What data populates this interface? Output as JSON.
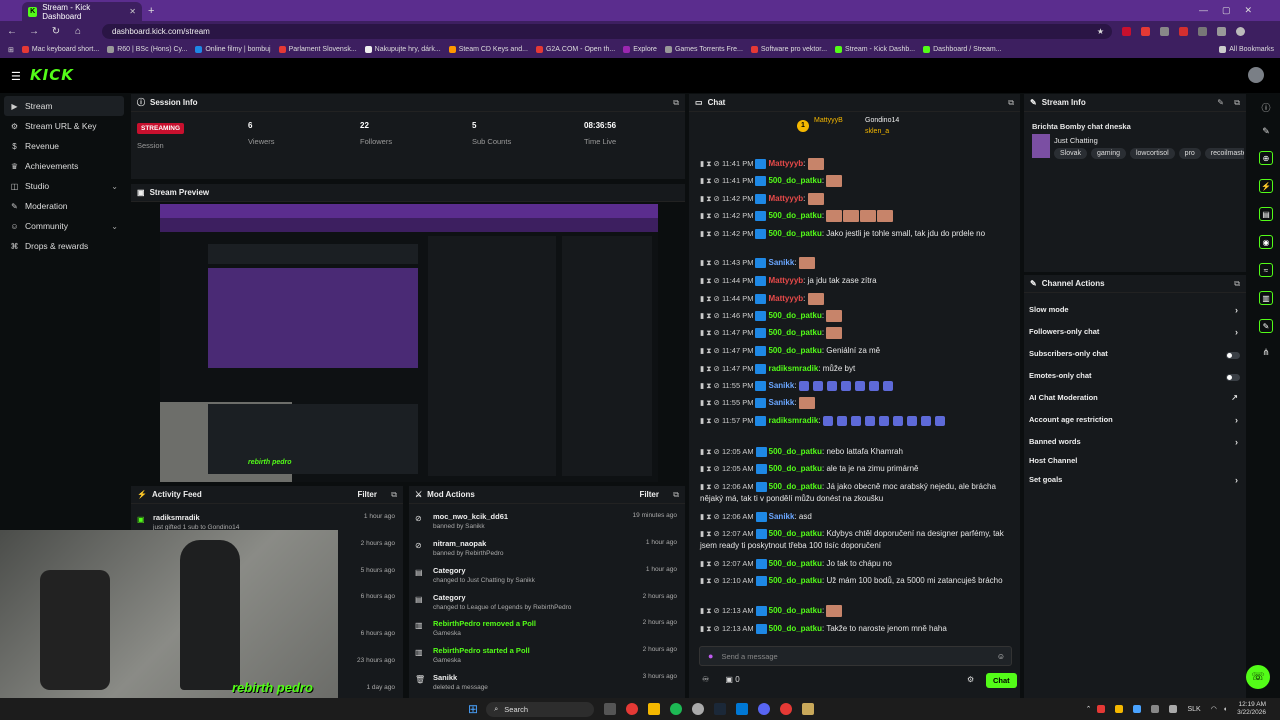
{
  "browser": {
    "tab_title": "Stream - Kick Dashboard",
    "url": "dashboard.kick.com/stream",
    "bookmarks": [
      "Mac keyboard short...",
      "R60 | BSc (Hons) Cy...",
      "Online filmy | bombuj",
      "Parlament Slovensk...",
      "Nakupujte hry, dárk...",
      "Steam CD Keys and...",
      "G2A.COM - Open th...",
      "Explore",
      "Games Torrents Fre...",
      "Software pro vektor...",
      "Stream - Kick Dashb...",
      "Dashboard / Stream..."
    ],
    "all_bookmarks": "All Bookmarks"
  },
  "brand": {
    "logo": "KICK",
    "accent": "#53fc18"
  },
  "sidebar": {
    "items": [
      {
        "label": "Stream",
        "icon": "play-icon"
      },
      {
        "label": "Stream URL & Key",
        "icon": "key-icon"
      },
      {
        "label": "Revenue",
        "icon": "dollar-icon"
      },
      {
        "label": "Achievements",
        "icon": "trophy-icon"
      },
      {
        "label": "Studio",
        "icon": "studio-icon"
      },
      {
        "label": "Moderation",
        "icon": "wrench-icon"
      },
      {
        "label": "Community",
        "icon": "people-icon"
      },
      {
        "label": "Drops & rewards",
        "icon": "gift-icon"
      }
    ]
  },
  "session": {
    "title": "Session Info",
    "badge": "STREAMING",
    "label": "Session",
    "stats": [
      {
        "value": "6",
        "label": "Viewers"
      },
      {
        "value": "22",
        "label": "Followers"
      },
      {
        "value": "5",
        "label": "Sub Counts"
      },
      {
        "value": "08:36:56",
        "label": "Time Live"
      }
    ]
  },
  "preview": {
    "title": "Stream Preview",
    "overlay_text": "rebirth pedro"
  },
  "activity": {
    "title": "Activity Feed",
    "filter": "Filter",
    "rows": [
      {
        "name": "radiksmradik",
        "sub": "just gifted 1 sub to Gondino14",
        "time": "1 hour ago"
      },
      {
        "name": "",
        "sub": "",
        "time": "2 hours ago"
      },
      {
        "name": "",
        "sub": "",
        "time": "5 hours ago"
      },
      {
        "name": "",
        "sub": "",
        "time": "6 hours ago"
      },
      {
        "name": "",
        "sub": "",
        "time": "6 hours ago"
      },
      {
        "name": "",
        "sub": "",
        "time": "23 hours ago"
      },
      {
        "name": "",
        "sub": "",
        "time": "1 day ago"
      }
    ]
  },
  "mod": {
    "title": "Mod Actions",
    "filter": "Filter",
    "rows": [
      {
        "title": "moc_nwo_kcik_dd61",
        "sub": "banned by Sanikk",
        "time": "19 minutes ago"
      },
      {
        "title": "nitram_naopak",
        "sub": "banned by RebirthPedro",
        "time": "1 hour ago"
      },
      {
        "title": "Category",
        "sub": "changed to Just Chatting by Sanikk",
        "time": "1 hour ago"
      },
      {
        "title": "Category",
        "sub": "changed to League of Legends by RebirthPedro",
        "time": "2 hours ago"
      },
      {
        "title": "RebirthPedro removed a Poll",
        "sub": "Gameska",
        "time": "2 hours ago"
      },
      {
        "title": "RebirthPedro started a Poll",
        "sub": "Gameska",
        "time": "2 hours ago"
      },
      {
        "title": "Sanikk",
        "sub": "deleted a message",
        "time": "3 hours ago"
      }
    ]
  },
  "chat": {
    "title": "Chat",
    "pinned": [
      {
        "name": "MattyyyB",
        "count": "1"
      },
      {
        "name": "Gondino14",
        "count": "1"
      },
      {
        "name": "sklen_a",
        "count": "1"
      }
    ],
    "messages": [
      {
        "time": "11:41 PM",
        "user": "Mattyyyb",
        "color": "#e84a4a",
        "text": "",
        "emotes": 1
      },
      {
        "time": "11:41 PM",
        "user": "500_do_patku",
        "color": "#53fc18",
        "text": "",
        "emotes": 1
      },
      {
        "time": "11:42 PM",
        "user": "Mattyyyb",
        "color": "#e84a4a",
        "text": "",
        "emotes": 1
      },
      {
        "time": "11:42 PM",
        "user": "500_do_patku",
        "color": "#53fc18",
        "text": "",
        "emotes": 4
      },
      {
        "time": "11:42 PM",
        "user": "500_do_patku",
        "color": "#53fc18",
        "text": "Jako jestli je tohle small, tak jdu do prdele no",
        "emotes": 0
      },
      {
        "time": "11:43 PM",
        "user": "Sanikk",
        "color": "#6aa6ff",
        "text": "",
        "emotes": 1
      },
      {
        "time": "11:44 PM",
        "user": "Mattyyyb",
        "color": "#e84a4a",
        "text": "ja jdu tak zase zítra",
        "emotes": 0
      },
      {
        "time": "11:44 PM",
        "user": "Mattyyyb",
        "color": "#e84a4a",
        "text": "",
        "emotes": 1
      },
      {
        "time": "11:46 PM",
        "user": "500_do_patku",
        "color": "#53fc18",
        "text": "",
        "emotes": 1
      },
      {
        "time": "11:47 PM",
        "user": "500_do_patku",
        "color": "#53fc18",
        "text": "",
        "emotes": 1
      },
      {
        "time": "11:47 PM",
        "user": "500_do_patku",
        "color": "#53fc18",
        "text": "Geniální za mě",
        "emotes": 0
      },
      {
        "time": "11:47 PM",
        "user": "radiksmradik",
        "color": "#53fc18",
        "text": "může byt",
        "emotes": 0
      },
      {
        "time": "11:55 PM",
        "user": "Sanikk",
        "color": "#6aa6ff",
        "text": "",
        "emotes": 7
      },
      {
        "time": "11:55 PM",
        "user": "Sanikk",
        "color": "#6aa6ff",
        "text": "",
        "emotes": 1
      },
      {
        "time": "11:57 PM",
        "user": "radiksmradik",
        "color": "#53fc18",
        "text": "",
        "emotes": 9
      },
      {
        "time": "12:05 AM",
        "user": "500_do_patku",
        "color": "#53fc18",
        "text": "nebo lattafa Khamrah",
        "emotes": 0
      },
      {
        "time": "12:05 AM",
        "user": "500_do_patku",
        "color": "#53fc18",
        "text": "ale ta je na zimu primárně",
        "emotes": 0
      },
      {
        "time": "12:06 AM",
        "user": "500_do_patku",
        "color": "#53fc18",
        "text": "Já jako obecně moc arabský nejedu, ale brácha nějaký má, tak ti v pondělí můžu donést na zkoušku",
        "emotes": 0
      },
      {
        "time": "12:06 AM",
        "user": "Sanikk",
        "color": "#6aa6ff",
        "text": "asd",
        "emotes": 0
      },
      {
        "time": "12:07 AM",
        "user": "500_do_patku",
        "color": "#53fc18",
        "text": "Kdybys chtěl doporučení na designer parfémy, tak jsem ready ti poskytnout třeba 100 tisíc doporučení",
        "emotes": 0
      },
      {
        "time": "12:07 AM",
        "user": "500_do_patku",
        "color": "#53fc18",
        "text": "Jo tak to chápu no",
        "emotes": 0
      },
      {
        "time": "12:10 AM",
        "user": "500_do_patku",
        "color": "#53fc18",
        "text": "Už mám 100 bodů, za 5000 mi zatancuješ brácho",
        "emotes": 0
      },
      {
        "time": "12:13 AM",
        "user": "500_do_patku",
        "color": "#53fc18",
        "text": "",
        "emotes": 1
      },
      {
        "time": "12:13 AM",
        "user": "500_do_patku",
        "color": "#53fc18",
        "text": "Takže to naroste jenom mně haha",
        "emotes": 0
      }
    ],
    "input_placeholder": "Send a message",
    "viewers_count": "0",
    "send_label": "Chat"
  },
  "stream_info": {
    "title": "Stream Info",
    "stream_title": "Brichta Bomby chat dneska",
    "category": "Just Chatting",
    "tags": [
      "Slovak",
      "gaming",
      "lowcortisol",
      "pro",
      "recoilmaste"
    ]
  },
  "channel_actions": {
    "title": "Channel Actions",
    "items": [
      {
        "label": "Slow mode",
        "control": "chevron"
      },
      {
        "label": "Followers-only chat",
        "control": "chevron"
      },
      {
        "label": "Subscribers-only chat",
        "control": "toggle"
      },
      {
        "label": "Emotes-only chat",
        "control": "toggle"
      },
      {
        "label": "AI Chat Moderation",
        "control": "external"
      },
      {
        "label": "Account age restriction",
        "control": "chevron"
      },
      {
        "label": "Banned words",
        "control": "chevron"
      },
      {
        "label": "Host Channel",
        "control": "none"
      },
      {
        "label": "Set goals",
        "control": "chevron"
      }
    ]
  },
  "taskbar": {
    "search": "Search",
    "lang": "SLK",
    "time": "12:19 AM",
    "date": "3/22/2026"
  }
}
